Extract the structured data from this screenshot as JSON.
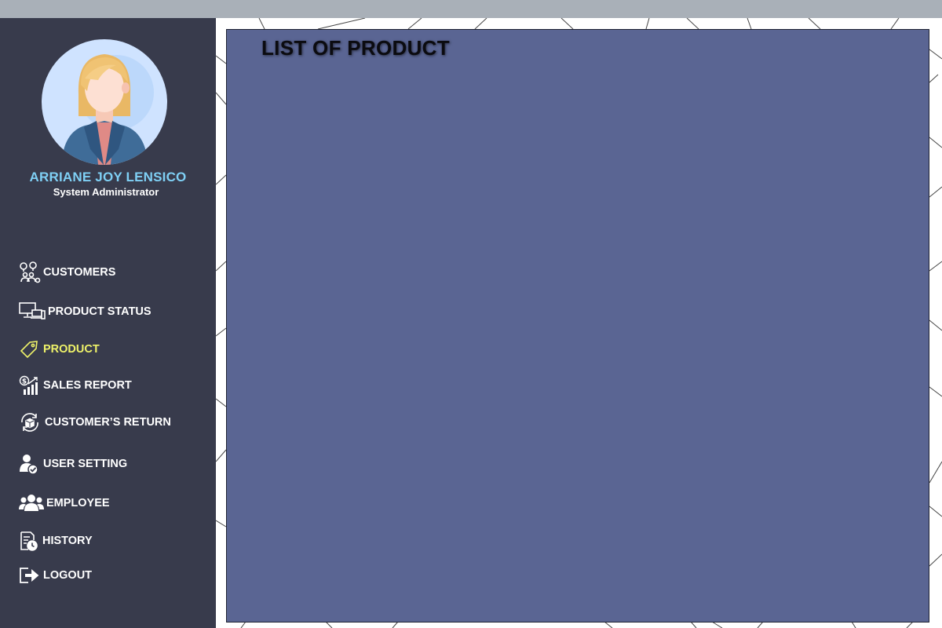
{
  "user": {
    "name": "ARRIANE JOY LENSICO",
    "role": "System Administrator"
  },
  "nav": {
    "items": [
      {
        "label": "CUSTOMERS",
        "icon": "customers-icon"
      },
      {
        "label": "PRODUCT STATUS",
        "icon": "monitor-devices-icon"
      },
      {
        "label": "PRODUCT",
        "icon": "price-tag-icon",
        "active": true
      },
      {
        "label": "SALES REPORT",
        "icon": "sales-chart-icon"
      },
      {
        "label": "CUSTOMER’S RETURN",
        "icon": "return-box-icon"
      },
      {
        "label": "USER SETTING",
        "icon": "user-check-icon"
      },
      {
        "label": "EMPLOYEE",
        "icon": "group-icon"
      },
      {
        "label": "HISTORY",
        "icon": "history-icon"
      },
      {
        "label": "LOGOUT",
        "icon": "logout-icon"
      }
    ]
  },
  "panel": {
    "title": "LIST OF PRODUCT"
  },
  "colors": {
    "sidebar": "#383b4c",
    "panel": "#5a6593",
    "accent_name": "#7fd0f5",
    "active_nav": "#eef269",
    "topbar": "#a9b0b8"
  }
}
